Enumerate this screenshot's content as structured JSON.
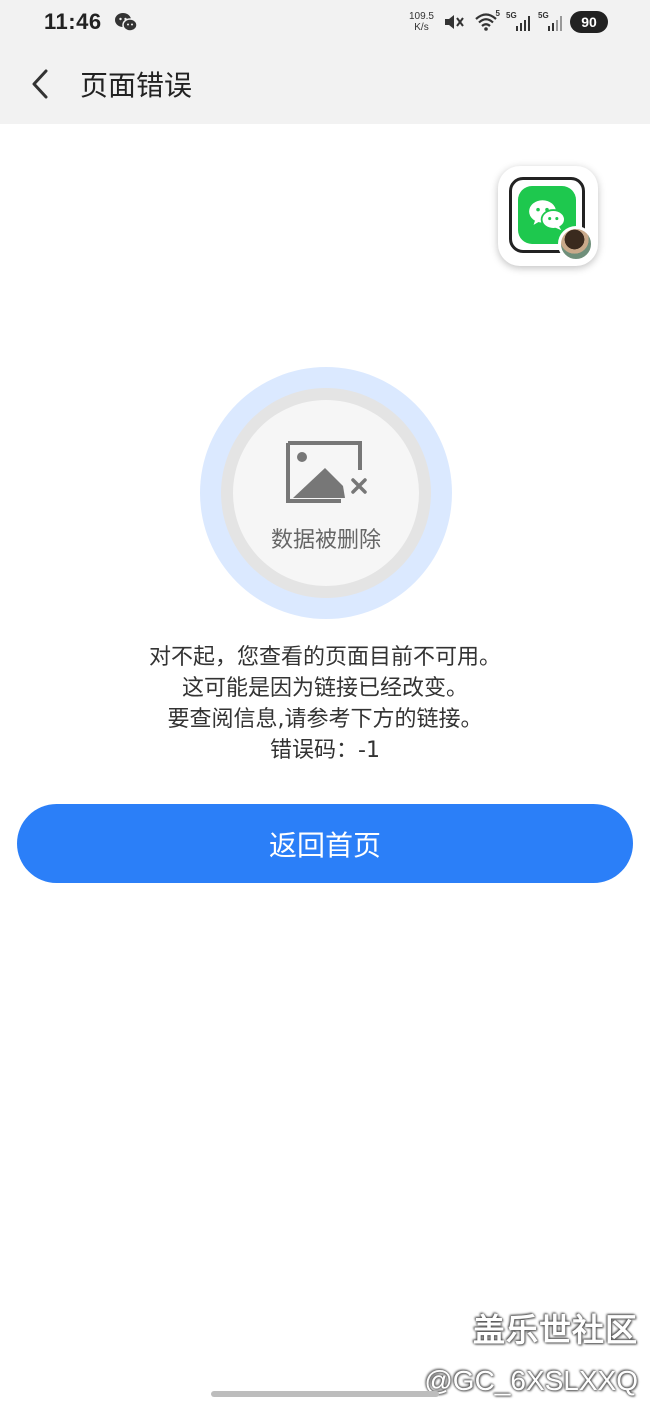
{
  "status_bar": {
    "time": "11:46",
    "net_speed_value": "109.5",
    "net_speed_unit": "K/s",
    "sim1_label": "5G",
    "sim2_label": "5G",
    "wifi_label": "5",
    "battery": "90",
    "icons": [
      "wechat-icon",
      "mute-icon",
      "wifi-icon",
      "signal-icon",
      "signal-icon",
      "battery-icon"
    ]
  },
  "app_bar": {
    "title": "页面错误",
    "back_icon": "chevron-left-icon"
  },
  "floating_app": {
    "icon": "wechat-icon"
  },
  "error_illustration": {
    "icon": "broken-image-icon",
    "label": "数据被删除",
    "colors": {
      "outer": "#dbe9ff",
      "ring": "#e4e4e4",
      "core": "#f6f6f6"
    }
  },
  "message": {
    "line1": "对不起，您查看的页面目前不可用。",
    "line2": "这可能是因为链接已经改变。",
    "line3": "要查阅信息,请参考下方的链接。",
    "line4": "错误码：-1"
  },
  "primary_button": {
    "label": "返回首页",
    "color": "#2b7ff8"
  },
  "watermark": {
    "title": "盖乐世社区",
    "user": "@GC_6XSLXXQ"
  }
}
